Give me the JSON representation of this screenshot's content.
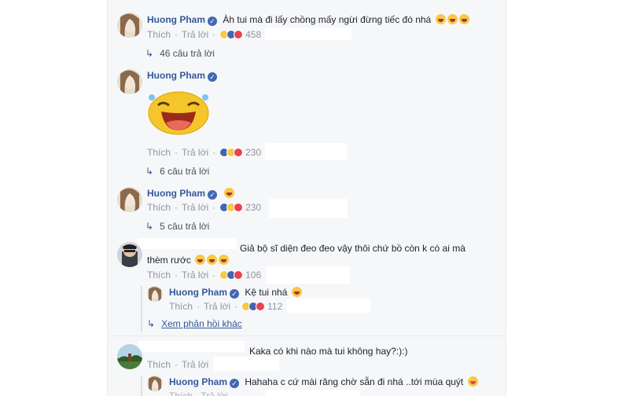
{
  "comments": [
    {
      "author": "Huong Pham",
      "text": "Àh tui mà đi lấy chồng mấy ngừi đừng tiếc đó nhá",
      "like": "Thích",
      "reply": "Trả lời",
      "count": "458",
      "replies": "46 câu trả lời"
    },
    {
      "author": "Huong Pham",
      "like": "Thích",
      "reply": "Trả lời",
      "count": "230",
      "replies": "6 câu trả lời"
    },
    {
      "author": "Huong Pham",
      "like": "Thích",
      "reply": "Trả lời",
      "count": "230",
      "replies": "5 câu trả lời"
    },
    {
      "text_line1": "Giả bộ sĩ diện đeo đeo vậy thôi chứ bồ còn k có ai mà",
      "text_line2": "thèm rước",
      "like": "Thích",
      "reply": "Trả lời",
      "count": "106"
    },
    {
      "text": "Kaka có khi nào mà tui không hay?:):)",
      "like": "Thích",
      "reply": "Trả lời"
    }
  ],
  "replies_nested": [
    {
      "author": "Huong Pham",
      "text": "Kệ tui nhá",
      "like": "Thích",
      "reply": "Trả lời",
      "count": "112",
      "more": "Xem phản hồi khác"
    },
    {
      "author": "Huong Pham",
      "text": "Hahaha c cứ mài răng chờ sẵn đi nhá ..tới mùa quýt"
    }
  ],
  "colors": {
    "link": "#365899",
    "meta": "#90949c",
    "bg": "#f6f7f9"
  }
}
